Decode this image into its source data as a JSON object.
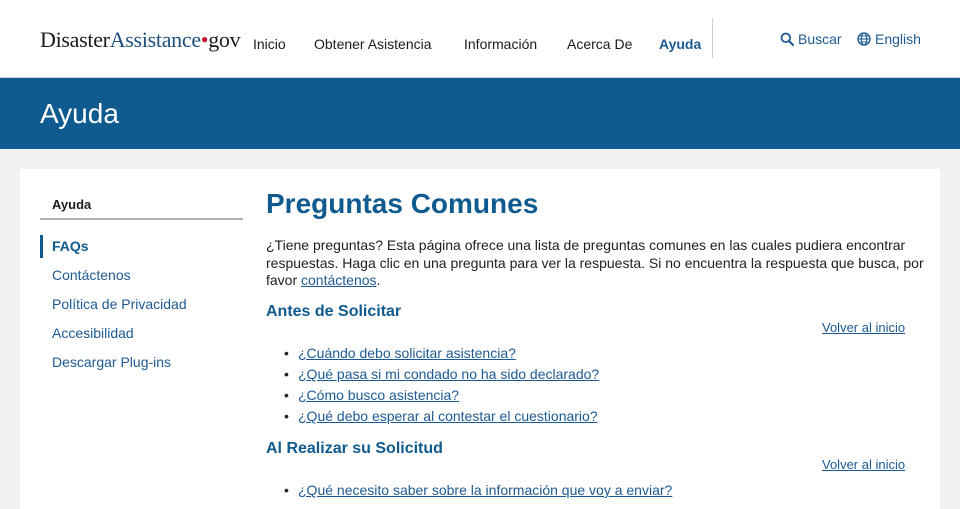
{
  "header": {
    "logo": {
      "part1": "Disaster",
      "part2": "Assistance",
      "dot": "•",
      "part3": "gov"
    },
    "nav": [
      "Inicio",
      "Obtener Asistencia",
      "Información",
      "Acerca De",
      "Ayuda"
    ],
    "active_nav": "Ayuda",
    "search_label": "Buscar",
    "language_label": "English"
  },
  "banner": {
    "title": "Ayuda"
  },
  "sidebar": {
    "title": "Ayuda",
    "items": [
      {
        "label": "FAQs",
        "active": true
      },
      {
        "label": "Contáctenos"
      },
      {
        "label": "Política de Privacidad"
      },
      {
        "label": "Accesibilidad"
      },
      {
        "label": "Descargar Plug-ins"
      }
    ]
  },
  "main": {
    "title": "Preguntas Comunes",
    "intro": {
      "text": "¿Tiene preguntas? Esta página ofrece una lista de preguntas comunes en las cuales pudiera encontrar respuestas. Haga clic en una pregunta para ver la respuesta. Si no encuentra la respuesta que busca, por favor ",
      "link": "contáctenos",
      "end": "."
    },
    "sections": [
      {
        "title": "Antes de Solicitar",
        "back_link": "Volver al inicio",
        "questions": [
          "¿Cuándo debo solicitar asistencia?",
          "¿Qué pasa si mi condado no ha sido declarado?",
          "¿Cómo busco asistencia?",
          "¿Qué debo esperar al contestar el cuestionario?"
        ]
      },
      {
        "title": "Al Realizar su Solicitud",
        "back_link": "Volver al inicio",
        "questions": [
          "¿Qué necesito saber sobre la información que voy a enviar?"
        ]
      }
    ]
  },
  "colors": {
    "brand_blue": "#0f5a8e",
    "link_blue": "#1d5a93",
    "seal_red": "#c41230"
  }
}
